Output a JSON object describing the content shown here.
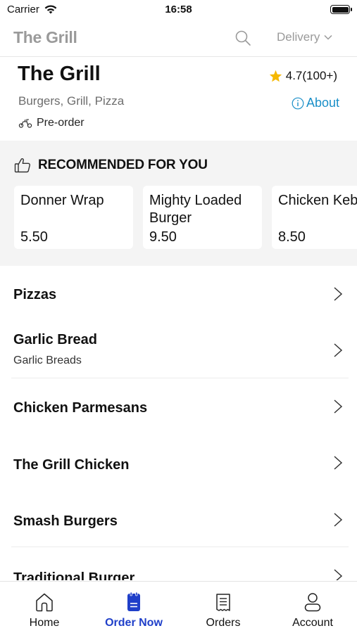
{
  "status_bar": {
    "carrier": "Carrier",
    "time": "16:58"
  },
  "header": {
    "title": "The Grill",
    "delivery_label": "Delivery"
  },
  "store": {
    "name": "The Grill",
    "rating": "4.7(100+)",
    "cuisines": "Burgers, Grill, Pizza",
    "about_label": "About",
    "preorder_label": "Pre-order"
  },
  "recommended": {
    "title": "RECOMMENDED FOR YOU",
    "items": [
      {
        "name": "Donner Wrap",
        "price": "5.50"
      },
      {
        "name": "Mighty Loaded Burger",
        "price": "9.50"
      },
      {
        "name": "Chicken Kebab",
        "price": "8.50"
      }
    ]
  },
  "categories": [
    {
      "name": "Pizzas",
      "subtitle": ""
    },
    {
      "name": "Garlic Bread",
      "subtitle": "Garlic Breads"
    },
    {
      "name": "Chicken Parmesans",
      "subtitle": ""
    },
    {
      "name": "The Grill Chicken",
      "subtitle": ""
    },
    {
      "name": "Smash Burgers",
      "subtitle": ""
    },
    {
      "name": "Traditional Burger",
      "subtitle": ""
    }
  ],
  "tabs": [
    {
      "label": "Home",
      "icon": "home-icon",
      "active": false
    },
    {
      "label": "Order Now",
      "icon": "order-icon",
      "active": true
    },
    {
      "label": "Orders",
      "icon": "receipt-icon",
      "active": false
    },
    {
      "label": "Account",
      "icon": "account-icon",
      "active": false
    }
  ],
  "colors": {
    "accent": "#1f3fc9",
    "link": "#1a8fc8",
    "star": "#f5b800",
    "muted": "#9a9a9a"
  }
}
